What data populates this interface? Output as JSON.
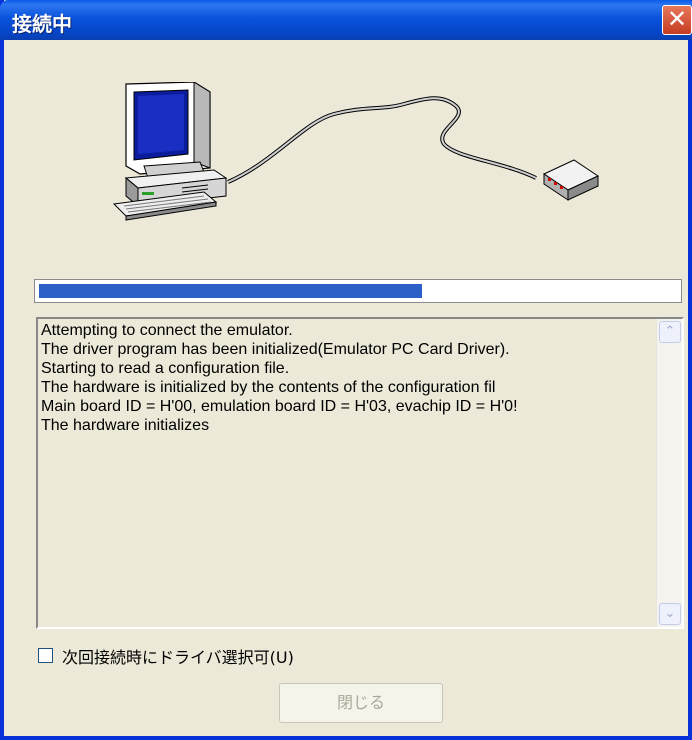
{
  "window": {
    "title": "接続中",
    "close_glyph": "✕"
  },
  "progress": {
    "value_fraction": 0.6
  },
  "log": {
    "lines": [
      "Attempting to connect the emulator.",
      "The driver program has been initialized(Emulator PC Card Driver).",
      "Starting to read a configuration file.",
      "The hardware is initialized by the contents of the configuration fil",
      "Main board ID = H'00, emulation board ID = H'03, evachip ID = H'0!",
      "The hardware initializes"
    ]
  },
  "scrollbar": {
    "up_glyph": "⌃",
    "down_glyph": "⌄"
  },
  "options": {
    "driver_select_label": "次回接続時にドライバ選択可(U)",
    "driver_select_checked": false
  },
  "buttons": {
    "close_label": "閉じる"
  },
  "icons": {
    "title_close": "close-icon",
    "illustration": [
      "computer-icon",
      "emulator-device-icon"
    ]
  }
}
